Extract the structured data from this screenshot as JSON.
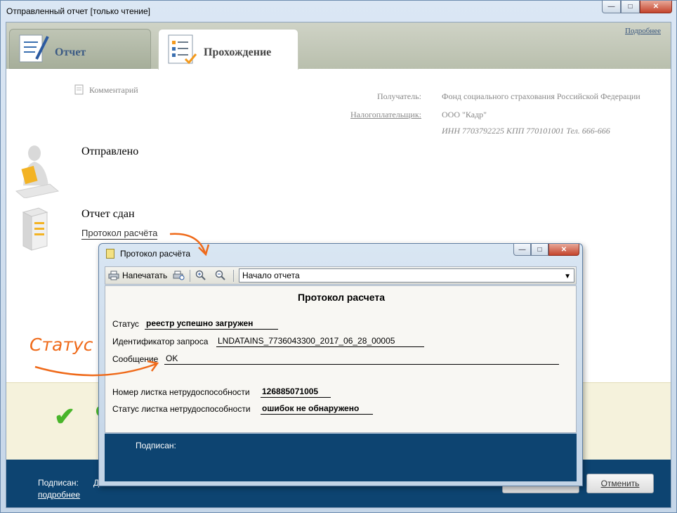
{
  "window": {
    "title": "Отправленный отчет [только чтение]",
    "more_link": "Подробнее"
  },
  "tabs": [
    {
      "label": "Отчет",
      "active": false
    },
    {
      "label": "Прохождение",
      "active": true
    }
  ],
  "comment_label": "Комментарий",
  "recipient": {
    "label": "Получатель:",
    "value": "Фонд социального страхования Российской Федерации"
  },
  "taxpayer": {
    "label": "Налогоплательщик:",
    "name": "ООО \"Кадр\"",
    "details": "ИНН 7703792225 КПП 770101001 Тел. 666-666"
  },
  "stages": [
    {
      "title": "Отправлено"
    },
    {
      "title": "Отчет сдан",
      "link": "Протокол расчёта"
    }
  ],
  "footer": {
    "signed_label": "Подписан:",
    "truncated": "Д",
    "details_link": "подробнее",
    "cancel_button": "Отменить"
  },
  "dialog": {
    "title": "Протокол расчёта",
    "toolbar": {
      "print": "Напечатать",
      "section_select": "Начало отчета"
    },
    "report": {
      "title": "Протокол расчета",
      "status_label": "Статус",
      "status_value": "реестр успешно загружен",
      "request_id_label": "Идентификатор запроса",
      "request_id_value": "LNDATAINS_7736043300_2017_06_28_00005",
      "message_label": "Сообщение",
      "message_value": "OK",
      "sheet_number_label": "Номер листка нетрудоспособности",
      "sheet_number_value": "126885071005",
      "sheet_status_label": "Статус листка нетрудоспособности",
      "sheet_status_value": "ошибок не обнаружено"
    },
    "signed_label": "Подписан:"
  },
  "annotation": {
    "text": "Статус",
    "color": "#ef6a1a"
  },
  "colors": {
    "footer_bg": "#0d4471",
    "success_green": "#48b52a",
    "tab_active_text": "#444444",
    "tab_inactive_text": "#3b5a84"
  }
}
